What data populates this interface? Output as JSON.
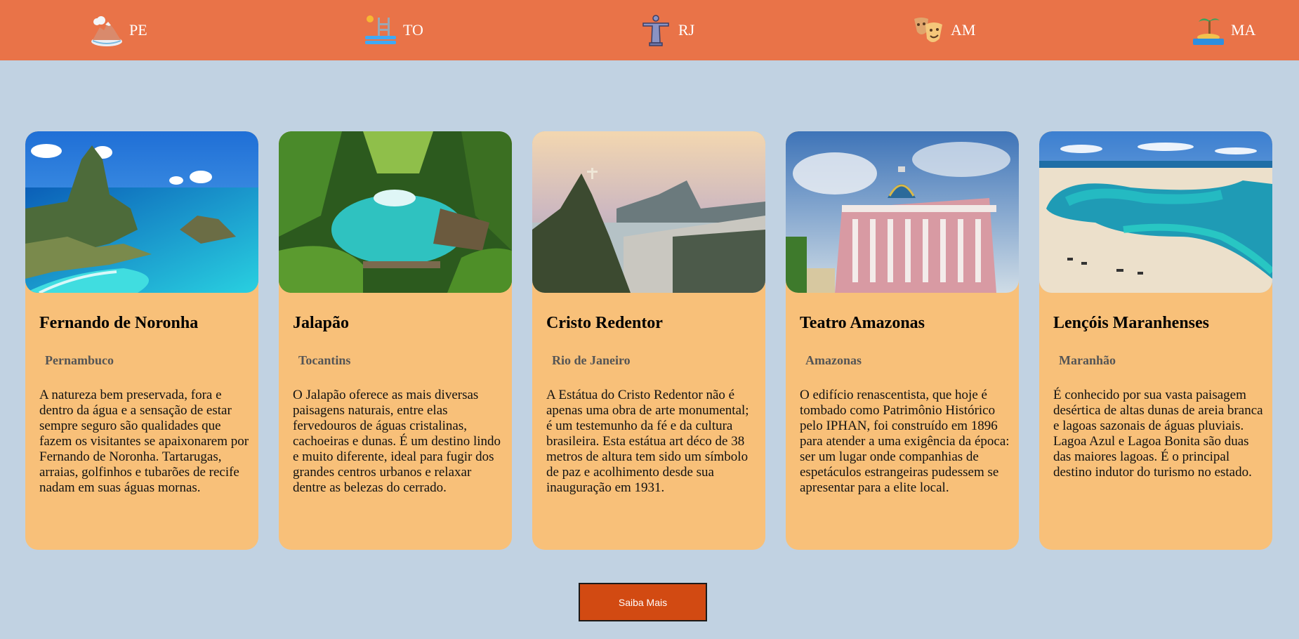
{
  "nav": {
    "items": [
      {
        "label": "PE",
        "icon": "volcano-island-icon"
      },
      {
        "label": "TO",
        "icon": "pool-ladder-icon"
      },
      {
        "label": "RJ",
        "icon": "christ-statue-icon"
      },
      {
        "label": "AM",
        "icon": "theater-masks-icon"
      },
      {
        "label": "MA",
        "icon": "desert-island-icon"
      }
    ]
  },
  "cards": [
    {
      "title": "Fernando de Noronha",
      "state": "Pernambuco",
      "description": "A natureza bem preservada, fora e dentro da água e a sensação de estar sempre seguro são qualidades que fazem os visitantes se apaixonarem por Fernando de Noronha. Tartarugas, arraias, golfinhos e tubarões de recife nadam em suas águas mornas."
    },
    {
      "title": "Jalapão",
      "state": "Tocantins",
      "description": "O Jalapão oferece as mais diversas paisagens naturais, entre elas fervedouros de águas cristalinas, cachoeiras e dunas. É um destino lindo e muito diferente, ideal para fugir dos grandes centros urbanos e relaxar dentre as belezas do cerrado."
    },
    {
      "title": "Cristo Redentor",
      "state": "Rio de Janeiro",
      "description": "A Estátua do Cristo Redentor não é apenas uma obra de arte monumental; é um testemunho da fé e da cultura brasileira. Esta estátua art déco de 38 metros de altura tem sido um símbolo de paz e acolhimento desde sua inauguração em 1931."
    },
    {
      "title": "Teatro Amazonas",
      "state": "Amazonas",
      "description": "O edifício renascentista, que hoje é tombado como Patrimônio Histórico pelo IPHAN, foi construído em 1896 para atender a uma exigência da época: ser um lugar onde companhias de espetáculos estrangeiras pudessem se apresentar para a elite local."
    },
    {
      "title": "Lençóis Maranhenses",
      "state": "Maranhão",
      "description": "É conhecido por sua vasta paisagem desértica de altas dunas de areia branca e lagoas sazonais de águas pluviais. Lagoa Azul e Lagoa Bonita são duas das maiores lagoas. É o principal destino indutor do turismo no estado."
    }
  ],
  "cta": {
    "label": "Saiba Mais"
  },
  "colors": {
    "nav": "#e97348",
    "background": "#c1d2e2",
    "card": "#f8c079",
    "button": "#d24a12"
  }
}
